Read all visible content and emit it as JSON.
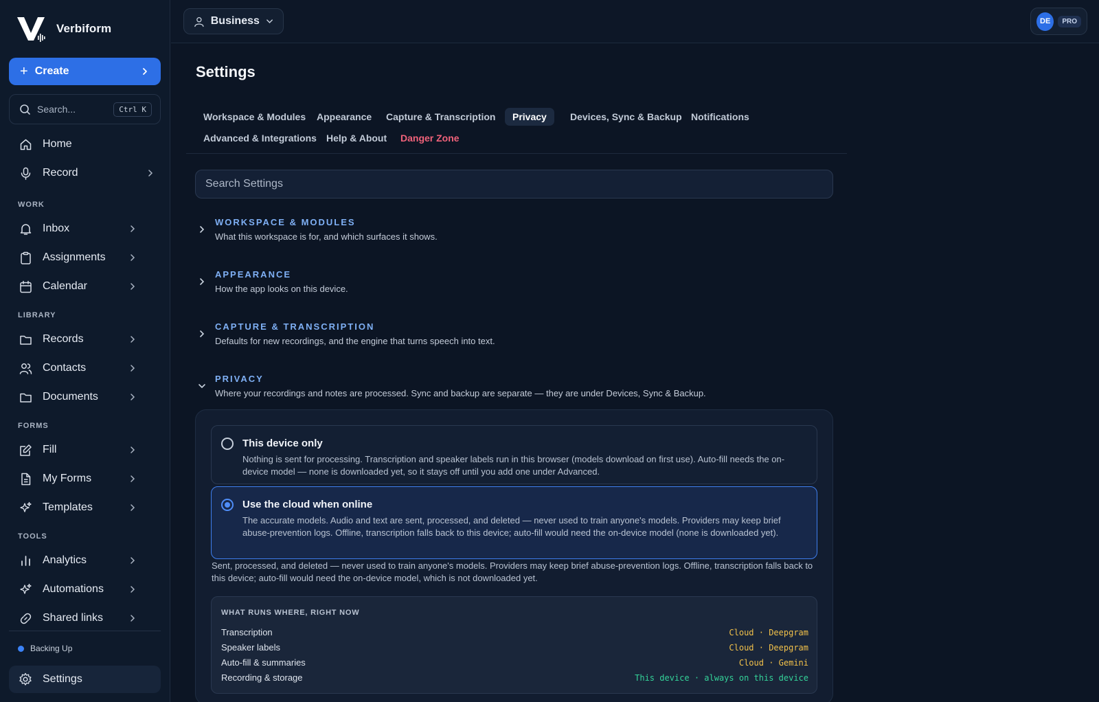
{
  "brand": {
    "name": "Verbiform"
  },
  "sidebar": {
    "create_label": "Create",
    "search_placeholder": "Search...",
    "search_shortcut": "Ctrl K",
    "top_items": [
      {
        "label": "Home",
        "icon": "home-icon"
      },
      {
        "label": "Record",
        "icon": "microphone-icon"
      }
    ],
    "sections": [
      {
        "label": "WORK",
        "items": [
          {
            "label": "Inbox",
            "icon": "bell-icon"
          },
          {
            "label": "Assignments",
            "icon": "clipboard-icon"
          },
          {
            "label": "Calendar",
            "icon": "calendar-icon"
          }
        ]
      },
      {
        "label": "LIBRARY",
        "items": [
          {
            "label": "Records",
            "icon": "folder-icon"
          },
          {
            "label": "Contacts",
            "icon": "users-icon"
          },
          {
            "label": "Documents",
            "icon": "folder-icon"
          }
        ]
      },
      {
        "label": "FORMS",
        "items": [
          {
            "label": "Fill",
            "icon": "edit-icon"
          },
          {
            "label": "My Forms",
            "icon": "document-icon"
          },
          {
            "label": "Templates",
            "icon": "sparkle-icon"
          }
        ]
      },
      {
        "label": "TOOLS",
        "items": [
          {
            "label": "Analytics",
            "icon": "bar-chart-icon"
          },
          {
            "label": "Automations",
            "icon": "sparkle-icon"
          },
          {
            "label": "Shared links",
            "icon": "link-icon"
          }
        ]
      }
    ],
    "status_text": "Backing Up",
    "settings_label": "Settings"
  },
  "topbar": {
    "workspace_label": "Business",
    "avatar_initials": "DE",
    "plan_badge": "PRO"
  },
  "main": {
    "title": "Settings",
    "tabs": [
      {
        "label": "Workspace & Modules"
      },
      {
        "label": "Appearance"
      },
      {
        "label": "Capture & Transcription"
      },
      {
        "label": "Privacy",
        "active": true
      },
      {
        "label": "Devices, Sync & Backup"
      },
      {
        "label": "Notifications"
      },
      {
        "label": "Advanced & Integrations"
      },
      {
        "label": "Help & About"
      },
      {
        "label": "Danger Zone",
        "danger": true
      }
    ],
    "search_placeholder": "Search Settings",
    "sections": [
      {
        "title": "WORKSPACE & MODULES",
        "description": "What this workspace is for, and which surfaces it shows.",
        "expanded": false
      },
      {
        "title": "APPEARANCE",
        "description": "How the app looks on this device.",
        "expanded": false
      },
      {
        "title": "CAPTURE & TRANSCRIPTION",
        "description": "Defaults for new recordings, and the engine that turns speech into text.",
        "expanded": false
      },
      {
        "title": "PRIVACY",
        "description": "Where your recordings and notes are processed. Sync and backup are separate — they are under Devices, Sync & Backup.",
        "expanded": true
      }
    ],
    "privacy": {
      "options": [
        {
          "title": "This device only",
          "description": "Nothing is sent for processing. Transcription and speaker labels run in this browser (models download on first use). Auto-fill needs the on-device model — none is downloaded yet, so it stays off until you add one under Advanced.",
          "selected": false
        },
        {
          "title": "Use the cloud when online",
          "description": "The accurate models. Audio and text are sent, processed, and deleted — never used to train anyone's models. Providers may keep brief abuse-prevention logs. Offline, transcription falls back to this device; auto-fill would need the on-device model (none is downloaded yet).",
          "selected": true
        }
      ],
      "note": "Sent, processed, and deleted — never used to train anyone's models. Providers may keep brief abuse-prevention logs. Offline, transcription falls back to this device; auto-fill would need the on-device model, which is not downloaded yet.",
      "runs": {
        "heading": "WHAT RUNS WHERE, RIGHT NOW",
        "rows": [
          {
            "label": "Transcription",
            "value": "Cloud · Deepgram"
          },
          {
            "label": "Speaker labels",
            "value": "Cloud · Deepgram"
          },
          {
            "label": "Auto-fill & summaries",
            "value": "Cloud · Gemini"
          },
          {
            "label": "Recording & storage",
            "value": "This device · always on this device"
          }
        ]
      }
    }
  },
  "colors": {
    "accent": "#2d6fe6",
    "cloud_value": "#f2c14a",
    "local_value": "#34d399",
    "danger": "#f0627a",
    "section_title": "#7fb0f5"
  }
}
